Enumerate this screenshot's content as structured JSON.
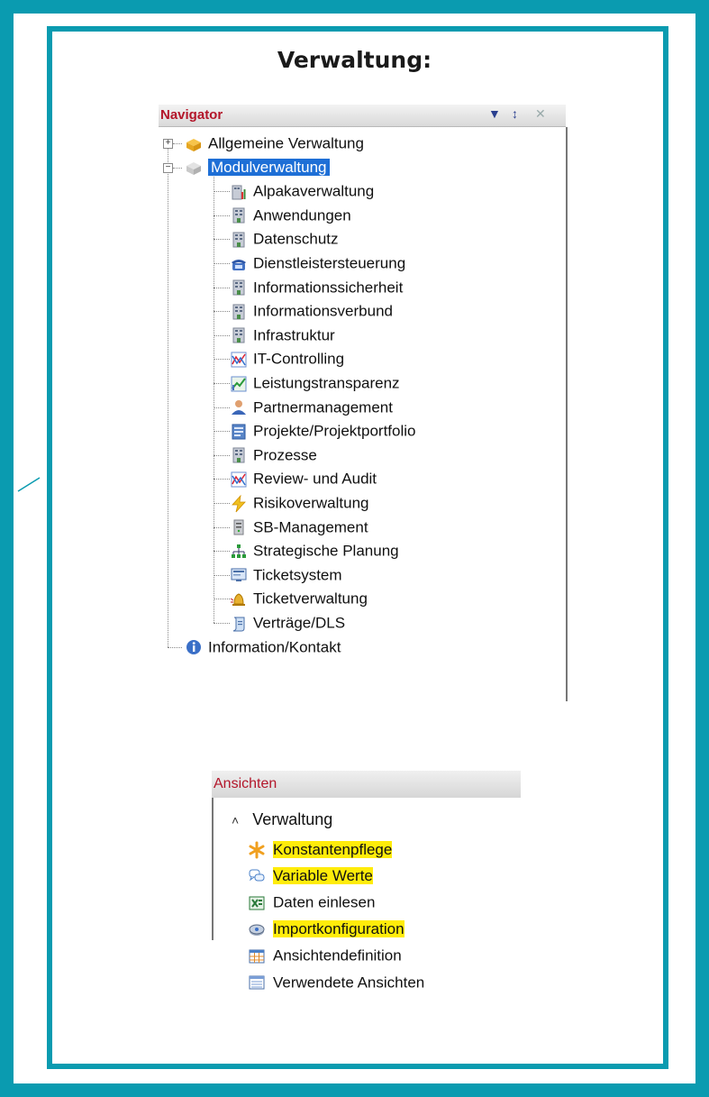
{
  "page_title": "Verwaltung:",
  "colors": {
    "frame": "#0a9bb0",
    "header_text": "#b3162a",
    "selection": "#1e6fd6",
    "highlight": "#ffec0a"
  },
  "navigator": {
    "title": "Navigator",
    "header_icons": [
      "dropdown-arrow-icon",
      "pin-icon",
      "close-icon"
    ],
    "roots": [
      {
        "label": "Allgemeine Verwaltung",
        "icon": "folder-box-icon",
        "expander": "+"
      },
      {
        "label": "Modulverwaltung",
        "icon": "module-box-icon",
        "expander": "−",
        "selected": true
      },
      {
        "label": "Information/Kontakt",
        "icon": "info-icon"
      }
    ],
    "modules": [
      {
        "label": "Alpakaverwaltung",
        "icon": "building-chart-icon"
      },
      {
        "label": "Anwendungen",
        "icon": "building-icon"
      },
      {
        "label": "Datenschutz",
        "icon": "building-icon"
      },
      {
        "label": "Dienstleistersteuerung",
        "icon": "telephone-icon"
      },
      {
        "label": "Informationssicherheit",
        "icon": "building-icon"
      },
      {
        "label": "Informationsverbund",
        "icon": "building-icon"
      },
      {
        "label": "Infrastruktur",
        "icon": "building-icon"
      },
      {
        "label": "IT-Controlling",
        "icon": "line-chart-icon"
      },
      {
        "label": "Leistungstransparenz",
        "icon": "trend-chart-icon"
      },
      {
        "label": "Partnermanagement",
        "icon": "person-icon"
      },
      {
        "label": "Projekte/Projektportfolio",
        "icon": "document-icon"
      },
      {
        "label": "Prozesse",
        "icon": "building-icon"
      },
      {
        "label": "Review- und Audit",
        "icon": "line-chart-icon"
      },
      {
        "label": "Risikoverwaltung",
        "icon": "lightning-icon"
      },
      {
        "label": "SB-Management",
        "icon": "server-icon"
      },
      {
        "label": "Strategische Planung",
        "icon": "org-chart-icon"
      },
      {
        "label": "Ticketsystem",
        "icon": "screen-icon"
      },
      {
        "label": "Ticketverwaltung",
        "icon": "bell-icon"
      },
      {
        "label": "Verträge/DLS",
        "icon": "scroll-icon"
      }
    ]
  },
  "ansichten": {
    "title": "Ansichten",
    "group": "Verwaltung",
    "items": [
      {
        "label": "Konstantenpflege",
        "icon": "asterisk-icon",
        "highlighted": true
      },
      {
        "label": "Variable Werte",
        "icon": "speech-bubbles-icon",
        "highlighted": true
      },
      {
        "label": "Daten einlesen",
        "icon": "excel-icon",
        "highlighted": false
      },
      {
        "label": "Importkonfiguration",
        "icon": "gear-import-icon",
        "highlighted": true
      },
      {
        "label": "Ansichtendefinition",
        "icon": "grid-icon",
        "highlighted": false
      },
      {
        "label": "Verwendete Ansichten",
        "icon": "list-icon",
        "highlighted": false
      }
    ]
  }
}
